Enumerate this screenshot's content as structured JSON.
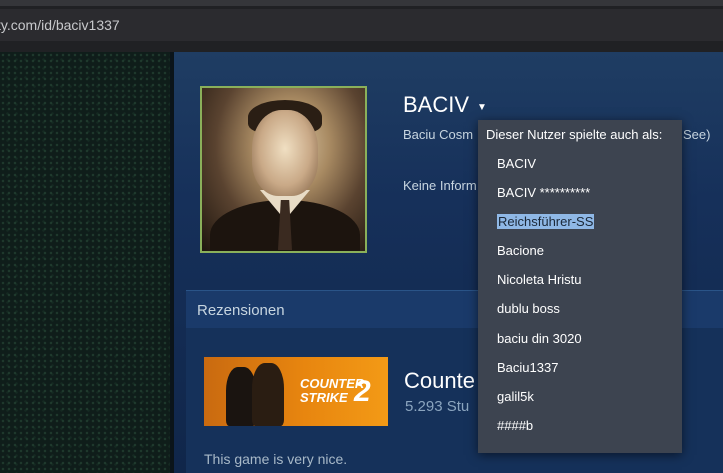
{
  "browser": {
    "url": "ty.com/id/baciv1337"
  },
  "profile": {
    "persona_name": "BACIV",
    "real_name": "Baciu Cosm",
    "real_name_tail": "See)",
    "info": "Keine Inform"
  },
  "reviews": {
    "header": "Rezensionen",
    "game_title": "Counte",
    "game_hours": "5.293 Stu",
    "review_text": "This game is very nice.",
    "capsule_logo_line1": "COUNTER",
    "capsule_logo_line2": "STRIKE",
    "capsule_logo_number": "2"
  },
  "alias_popup": {
    "title": "Dieser Nutzer spielte auch als:",
    "aliases": [
      "BACIV",
      "BACIV **********",
      "Reichsführer-SS",
      "Bacione",
      "Nicoleta Hristu",
      "dublu boss",
      "baciu din 3020",
      "Baciu1337",
      "galil5k",
      "####b"
    ],
    "selected_index": 2
  },
  "colors": {
    "page_bg": "#1b2838",
    "avatar_border": "#8ab05a",
    "popup_bg": "#3d4450",
    "highlight": "#8fb8e6"
  }
}
